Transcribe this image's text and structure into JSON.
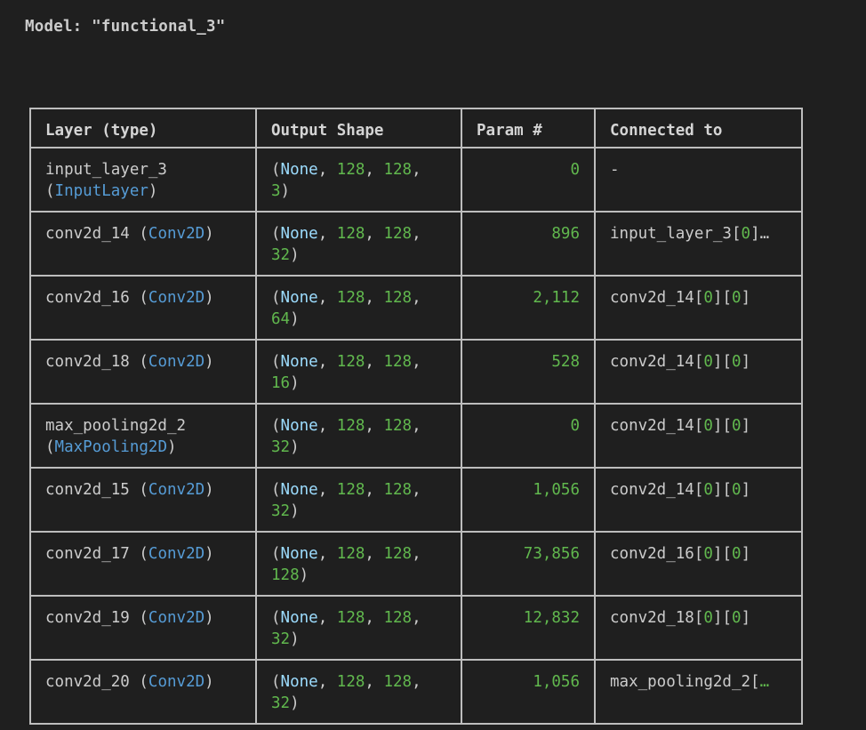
{
  "model_title": "Model: \"functional_3\"",
  "columns": {
    "layer": "Layer (type)",
    "shape": "Output Shape",
    "param": "Param #",
    "connected": "Connected to"
  },
  "rows": [
    {
      "name": "input_layer_3",
      "type": "InputLayer",
      "shape_line1": {
        "open": "(",
        "none": "None",
        "sep1": ", ",
        "a": "128",
        "sep2": ", ",
        "b": "128",
        "trail": ","
      },
      "shape_line2": {
        "c": "3",
        "close": ")"
      },
      "param": "0",
      "connected_text": "-",
      "connected_idx": ""
    },
    {
      "name": "conv2d_14",
      "type": "Conv2D",
      "shape_line1": {
        "open": "(",
        "none": "None",
        "sep1": ", ",
        "a": "128",
        "sep2": ", ",
        "b": "128",
        "trail": ","
      },
      "shape_line2": {
        "c": "32",
        "close": ")"
      },
      "param": "896",
      "connected_text": "input_layer_3[",
      "connected_idx": "0]…"
    },
    {
      "name": "conv2d_16",
      "type": "Conv2D",
      "shape_line1": {
        "open": "(",
        "none": "None",
        "sep1": ", ",
        "a": "128",
        "sep2": ", ",
        "b": "128",
        "trail": ","
      },
      "shape_line2": {
        "c": "64",
        "close": ")"
      },
      "param": "2,112",
      "connected_text": "conv2d_14[0][0]",
      "connected_idx": ""
    },
    {
      "name": "conv2d_18",
      "type": "Conv2D",
      "shape_line1": {
        "open": "(",
        "none": "None",
        "sep1": ", ",
        "a": "128",
        "sep2": ", ",
        "b": "128",
        "trail": ","
      },
      "shape_line2": {
        "c": "16",
        "close": ")"
      },
      "param": "528",
      "connected_text": "conv2d_14[0][0]",
      "connected_idx": ""
    },
    {
      "name": "max_pooling2d_2",
      "type": "MaxPooling2D",
      "shape_line1": {
        "open": "(",
        "none": "None",
        "sep1": ", ",
        "a": "128",
        "sep2": ", ",
        "b": "128",
        "trail": ","
      },
      "shape_line2": {
        "c": "32",
        "close": ")"
      },
      "param": "0",
      "connected_text": "conv2d_14[0][0]",
      "connected_idx": ""
    },
    {
      "name": "conv2d_15",
      "type": "Conv2D",
      "shape_line1": {
        "open": "(",
        "none": "None",
        "sep1": ", ",
        "a": "128",
        "sep2": ", ",
        "b": "128",
        "trail": ","
      },
      "shape_line2": {
        "c": "32",
        "close": ")"
      },
      "param": "1,056",
      "connected_text": "conv2d_14[0][0]",
      "connected_idx": ""
    },
    {
      "name": "conv2d_17",
      "type": "Conv2D",
      "shape_line1": {
        "open": "(",
        "none": "None",
        "sep1": ", ",
        "a": "128",
        "sep2": ", ",
        "b": "128",
        "trail": ","
      },
      "shape_line2": {
        "c": "128",
        "close": ")"
      },
      "param": "73,856",
      "connected_text": "conv2d_16[0][0]",
      "connected_idx": ""
    },
    {
      "name": "conv2d_19",
      "type": "Conv2D",
      "shape_line1": {
        "open": "(",
        "none": "None",
        "sep1": ", ",
        "a": "128",
        "sep2": ", ",
        "b": "128",
        "trail": ","
      },
      "shape_line2": {
        "c": "32",
        "close": ")"
      },
      "param": "12,832",
      "connected_text": "conv2d_18[0][0]",
      "connected_idx": ""
    },
    {
      "name": "conv2d_20",
      "type": "Conv2D",
      "shape_line1": {
        "open": "(",
        "none": "None",
        "sep1": ", ",
        "a": "128",
        "sep2": ", ",
        "b": "128",
        "trail": ","
      },
      "shape_line2": {
        "c": "32",
        "close": ")"
      },
      "param": "1,056",
      "connected_text": "max_pooling2d_2[",
      "connected_idx": "…"
    }
  ],
  "colors": {
    "background": "#1f1f1f",
    "text": "#cccccc",
    "class_name": "#569cd6",
    "none_keyword": "#9cdcfe",
    "number": "#61b84e",
    "border": "#bdbdbd"
  }
}
